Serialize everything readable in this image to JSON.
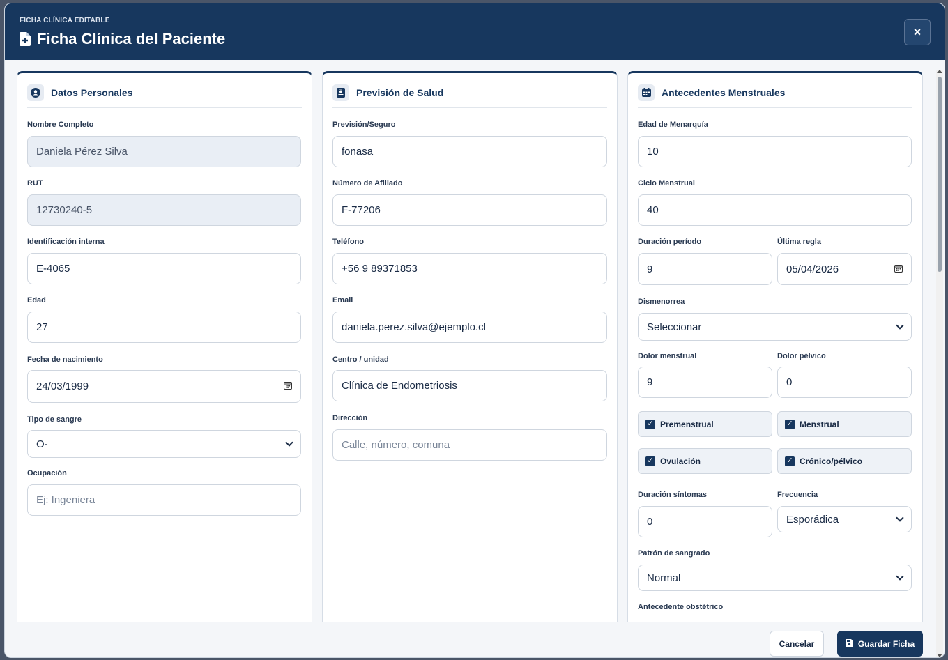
{
  "header": {
    "eyebrow": "FICHA CLÍNICA EDITABLE",
    "title": "Ficha Clínica del Paciente",
    "close_label": "×"
  },
  "personal": {
    "title": "Datos Personales",
    "nombre_label": "Nombre Completo",
    "nombre_value": "Daniela Pérez Silva",
    "rut_label": "RUT",
    "rut_value": "12730240-5",
    "idint_label": "Identificación interna",
    "idint_value": "E-4065",
    "edad_label": "Edad",
    "edad_value": "27",
    "fnac_label": "Fecha de nacimiento",
    "fnac_value": "24/03/1999",
    "sangre_label": "Tipo de sangre",
    "sangre_value": "O-",
    "ocup_label": "Ocupación",
    "ocup_placeholder": "Ej: Ingeniera"
  },
  "prevision": {
    "title": "Previsión de Salud",
    "prev_label": "Previsión/Seguro",
    "prev_value": "fonasa",
    "afil_label": "Número de Afiliado",
    "afil_value": "F-77206",
    "tel_label": "Teléfono",
    "tel_value": "+56 9 89371853",
    "email_label": "Email",
    "email_value": "daniela.perez.silva@ejemplo.cl",
    "centro_label": "Centro / unidad",
    "centro_value": "Clínica de Endometriosis",
    "dir_label": "Dirección",
    "dir_placeholder": "Calle, número, comuna"
  },
  "menstrual": {
    "title": "Antecedentes Menstruales",
    "menarq_label": "Edad de Menarquía",
    "menarq_value": "10",
    "ciclo_label": "Ciclo Menstrual",
    "ciclo_value": "40",
    "durper_label": "Duración período",
    "durper_value": "9",
    "ultreg_label": "Última regla",
    "ultreg_value": "05/04/2026",
    "dismen_label": "Dismenorrea",
    "dismen_value": "Seleccionar",
    "dolmen_label": "Dolor menstrual",
    "dolmen_value": "9",
    "dolpel_label": "Dolor pélvico",
    "dolpel_value": "0",
    "chk_premenstrual": "Premenstrual",
    "chk_menstrual": "Menstrual",
    "chk_ovulacion": "Ovulación",
    "chk_cronico": "Crónico/pélvico",
    "dursin_label": "Duración síntomas",
    "dursin_value": "0",
    "frec_label": "Frecuencia",
    "frec_value": "Esporádica",
    "patron_label": "Patrón de sangrado",
    "patron_value": "Normal",
    "obst_label": "Antecedente obstétrico"
  },
  "footer": {
    "cancel_label": "Cancelar",
    "save_label": "Guardar Ficha"
  }
}
